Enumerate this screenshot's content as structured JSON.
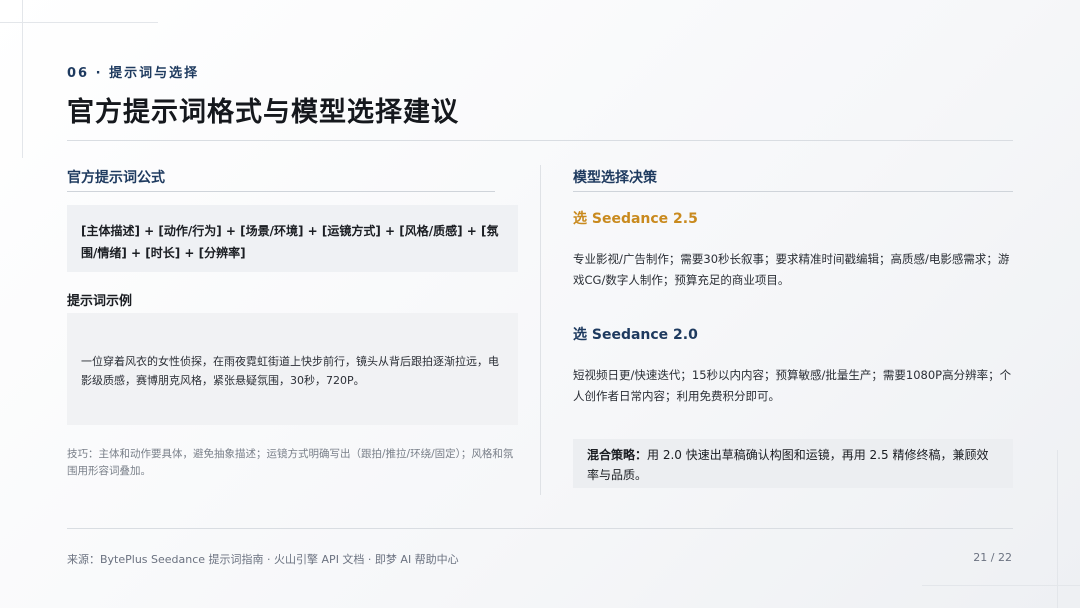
{
  "header": {
    "section_tag": "06 · 提示词与选择",
    "title": "官方提示词格式与模型选择建议"
  },
  "left": {
    "heading": "官方提示词公式",
    "formula": "[主体描述] + [动作/行为] + [场景/环境] + [运镜方式] + [风格/质感] + [氛围/情绪] + [时长] + [分辨率]",
    "example_heading": "提示词示例",
    "example_text": "一位穿着风衣的女性侦探，在雨夜霓虹街道上快步前行，镜头从背后跟拍逐渐拉远，电影级质感，赛博朋克风格，紧张悬疑氛围，30秒，720P。",
    "tip": "技巧：主体和动作要具体，避免抽象描述；运镜方式明确写出（跟拍/推拉/环绕/固定）；风格和氛围用形容词叠加。"
  },
  "right": {
    "heading": "模型选择决策",
    "option1_name": "选 Seedance 2.5",
    "option1_desc": "专业影视/广告制作；需要30秒长叙事；要求精准时间戳编辑；高质感/电影感需求；游戏CG/数字人制作；预算充足的商业项目。",
    "option2_name": "选 Seedance 2.0",
    "option2_desc": "短视频日更/快速迭代；15秒以内内容；预算敏感/批量生产；需要1080P高分辨率；个人创作者日常内容；利用免费积分即可。",
    "mix_label": "混合策略：",
    "mix_text": "用 2.0 快速出草稿确认构图和运镜，再用 2.5 精修终稿，兼顾效率与品质。"
  },
  "footer": {
    "source": "来源：BytePlus Seedance 提示词指南 · 火山引擎 API 文档 · 即梦 AI 帮助中心",
    "page": "21 / 22"
  },
  "colors": {
    "accent_navy": "#1e3a5f",
    "accent_gold": "#c98a1e",
    "option2_color": "#1e3a5f"
  }
}
